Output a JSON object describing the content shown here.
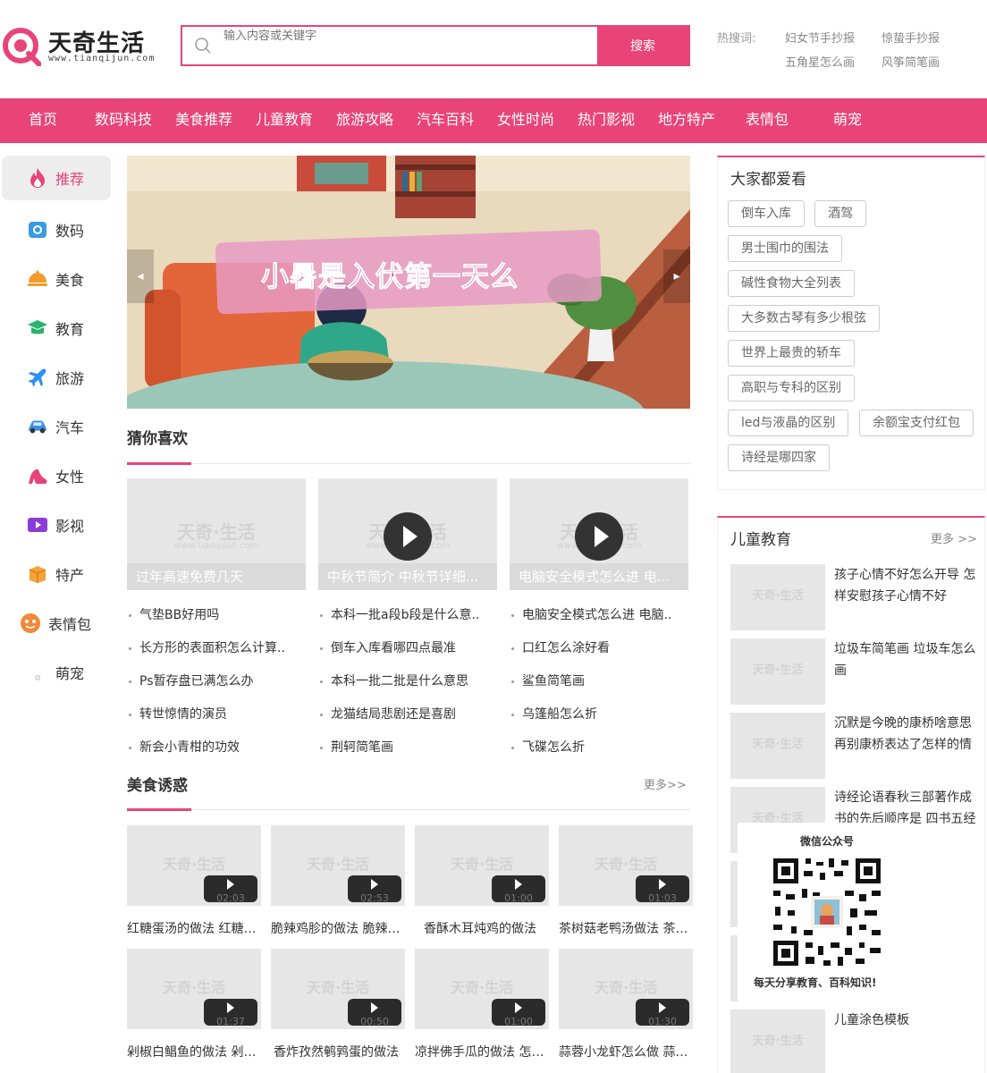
{
  "brand": {
    "title": "天奇生活",
    "url": "www.tianqijun.com",
    "accent": "#e8447a"
  },
  "search": {
    "placeholder": "输入内容或关键字",
    "button": "搜索"
  },
  "hot": {
    "label": "热搜词:",
    "links": [
      "妇女节手抄报",
      "惊蛰手抄报",
      "五角星怎么画",
      "风筝简笔画"
    ]
  },
  "nav": [
    "首页",
    "数码科技",
    "美食推荐",
    "儿童教育",
    "旅游攻略",
    "汽车百科",
    "女性时尚",
    "热门影视",
    "地方特产",
    "表情包",
    "萌宠"
  ],
  "sidebar": [
    {
      "label": "推荐",
      "icon": "fire-icon"
    },
    {
      "label": "数码",
      "icon": "camera-icon"
    },
    {
      "label": "美食",
      "icon": "dish-icon"
    },
    {
      "label": "教育",
      "icon": "graduation-cap-icon"
    },
    {
      "label": "旅游",
      "icon": "airplane-icon"
    },
    {
      "label": "汽车",
      "icon": "car-icon"
    },
    {
      "label": "女性",
      "icon": "high-heel-icon"
    },
    {
      "label": "影视",
      "icon": "video-icon"
    },
    {
      "label": "特产",
      "icon": "gift-box-icon"
    },
    {
      "label": "表情包",
      "icon": "emoji-icon"
    },
    {
      "label": "萌宠",
      "icon": "pet-icon"
    }
  ],
  "banner": {
    "title": "小暑是入伏第一天么"
  },
  "guess": {
    "title": "猜你喜欢",
    "cards": [
      {
        "caption": "过年高速免费几天",
        "video": false
      },
      {
        "caption": "中秋节简介 中秋节详细...",
        "video": true
      },
      {
        "caption": "电脑安全模式怎么进 电...",
        "video": true
      }
    ],
    "columns": [
      [
        "气垫BB好用吗",
        "长方形的表面积怎么计算..",
        "Ps暂存盘已满怎么办",
        "转世惊情的演员",
        "新会小青柑的功效"
      ],
      [
        "本科一批a段b段是什么意..",
        "倒车入库看哪四点最准",
        "本科一批二批是什么意思",
        "龙猫结局悲剧还是喜剧",
        "荆轲简笔画"
      ],
      [
        "电脑安全模式怎么进 电脑..",
        "口红怎么涂好看",
        "鲨鱼简笔画",
        "乌篷船怎么折",
        "飞碟怎么折"
      ]
    ]
  },
  "food": {
    "title": "美食诱惑",
    "more": "更多>>",
    "items": [
      {
        "caption": "红糖蛋汤的做法 红糖蛋...",
        "duration": "02:03"
      },
      {
        "caption": "脆辣鸡胗的做法 脆辣鸡...",
        "duration": "02:53"
      },
      {
        "caption": "香酥木耳炖鸡的做法",
        "duration": "01:00"
      },
      {
        "caption": "茶树菇老鸭汤做法 茶树...",
        "duration": "01:03"
      },
      {
        "caption": "剁椒白鲳鱼的做法 剁椒...",
        "duration": "01:37"
      },
      {
        "caption": "香炸孜然鹌鹑蛋的做法",
        "duration": "00:50"
      },
      {
        "caption": "凉拌佛手瓜的做法 怎么...",
        "duration": "01:00"
      },
      {
        "caption": "蒜蓉小龙虾怎么做 蒜蓉...",
        "duration": "01:30"
      }
    ]
  },
  "popular": {
    "title": "大家都爱看",
    "tags": [
      "倒车入库",
      "酒驾",
      "男士围巾的围法",
      "碱性食物大全列表",
      "大多数古琴有多少根弦",
      "世界上最贵的轿车",
      "高职与专科的区别",
      "led与液晶的区别",
      "余额宝支付红包",
      "诗经是哪四家"
    ]
  },
  "edu": {
    "title": "儿童教育",
    "more": "更多 >>",
    "items": [
      "孩子心情不好怎么开导 怎样安慰孩子心情不好",
      "垃圾车简笔画 垃圾车怎么画",
      "沉默是今晚的康桥啥意思 再别康桥表达了怎样的情",
      "诗经论语春秋三部著作成书的先后顺序是 四书五经",
      "儿童涂色模板"
    ]
  },
  "wechat": {
    "title": "微信公众号",
    "caption": "每天分享教育、百科知识!"
  },
  "watermark": {
    "main": "天奇·生活",
    "sub": "www.tianqijun.com"
  }
}
